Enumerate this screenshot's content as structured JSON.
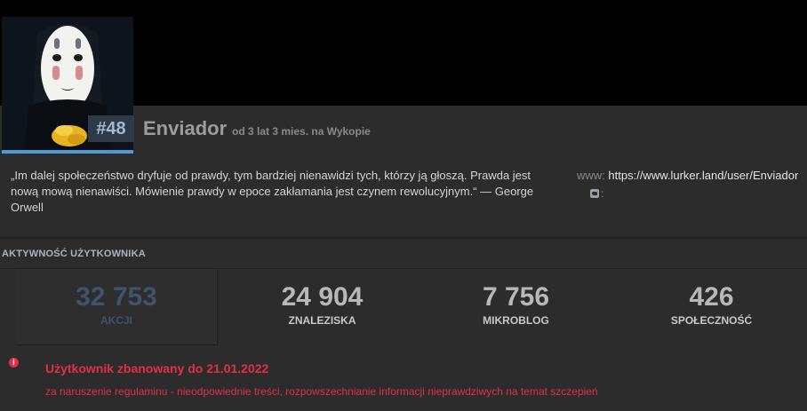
{
  "profile": {
    "rank": "#48",
    "username": "Enviador",
    "since": "od 3 lat 3 mies. na Wykopie",
    "bio": "„Im dalej społeczeństwo dryfuje od prawdy, tym bardziej nienawidzi tych, którzy ją głoszą. Prawda jest nową mową nienawiści. Mówienie prawdy w epoce zakłamania jest czynem rewolucyjnym.“ — George Orwell",
    "www_label": "www:",
    "www_value": "https://www.lurker.land/user/Enviador",
    "twitter_suffix": ":"
  },
  "activity": {
    "title": "AKTYWNOŚĆ UŻYTKOWNIKA",
    "stats": [
      {
        "value": "32 753",
        "label": "AKCJI"
      },
      {
        "value": "24 904",
        "label": "ZNALEZISKA"
      },
      {
        "value": "7 756",
        "label": "MIKROBLOG"
      },
      {
        "value": "426",
        "label": "SPOŁECZNOŚĆ"
      }
    ]
  },
  "ban": {
    "title": "Użytkownik zbanowany do 21.01.2022",
    "reason": "za naruszenie regulaminu - nieodpowiednie treści, rozpowszechnianie informacji nieprawdziwych na temat szczepień"
  },
  "icons": {
    "twitter": "twitter-icon",
    "ban": "info-icon"
  },
  "colors": {
    "accent": "#4d9bd6",
    "ban": "#e0304a",
    "active_stat": "#3e5468"
  }
}
